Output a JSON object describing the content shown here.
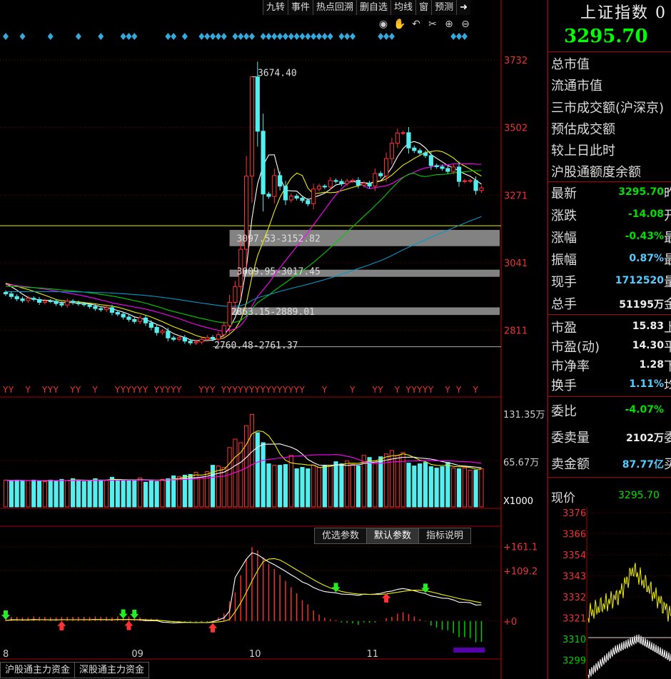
{
  "toolbar": {
    "items": [
      "九转",
      "事件",
      "热点回溯",
      "删自选",
      "均线",
      "窗",
      "预测"
    ],
    "exit_icon": "exit-icon"
  },
  "controls": [
    "eye-icon",
    "hand-icon",
    "undo-icon",
    "scissors-icon",
    "zoom-in-icon",
    "zoom-out-icon"
  ],
  "right_panel": {
    "title": "上证指数 0",
    "price": "3295.70",
    "static_rows": [
      "总市值",
      "流通市值",
      "三市成交额(沪深京)",
      "预估成交额",
      "较上日此时",
      "沪股通额度余额"
    ],
    "quote_rows": [
      {
        "label": "最新",
        "value": "3295.70",
        "color": "green",
        "tail": "昨"
      },
      {
        "label": "涨跌",
        "value": "-14.08",
        "color": "green",
        "tail": "开"
      },
      {
        "label": "涨幅",
        "value": "-0.43%",
        "color": "green",
        "tail": "最"
      },
      {
        "label": "振幅",
        "value": "0.87%",
        "color": "cyan",
        "tail": "最"
      },
      {
        "label": "现手",
        "value": "1712520",
        "color": "cyan",
        "tail": "量"
      },
      {
        "label": "总手",
        "value": "51195万",
        "color": "white",
        "tail": "金"
      }
    ],
    "val_rows": [
      {
        "label": "市盈",
        "value": "15.83",
        "color": "white",
        "tail": "上"
      },
      {
        "label": "市盈(动)",
        "value": "14.30",
        "color": "white",
        "tail": "平"
      },
      {
        "label": "市净率",
        "value": "1.28",
        "color": "white",
        "tail": "下"
      },
      {
        "label": "换手",
        "value": "1.11%",
        "color": "cyan",
        "tail": "均"
      }
    ],
    "order_rows": [
      {
        "label": "委比",
        "value": "-4.07%",
        "color": "green",
        "tail": ""
      },
      {
        "label": "委卖量",
        "value": "2102万",
        "color": "white",
        "tail": "委"
      },
      {
        "label": "卖金额",
        "value": "87.77亿",
        "color": "cyan",
        "tail": "买"
      }
    ],
    "now_label": "现价",
    "now_value": "3295.70",
    "mini_axis": [
      "3376",
      "3366",
      "3354",
      "3343",
      "3332",
      "3321",
      "3310",
      "3299"
    ]
  },
  "indicator_buttons": [
    "优选参数",
    "默认参数",
    "指标说明"
  ],
  "bottom_tabs": [
    "沪股通主力资金",
    "深股通主力资金"
  ],
  "chart_data": {
    "type": "candlestick",
    "price_axis_labels": [
      "3732",
      "3502",
      "3271",
      "3041",
      "2811"
    ],
    "price_range": [
      2720,
      3790
    ],
    "annotations": [
      "3674.40",
      "3097.53-3152.82",
      "3009.95-3017.45",
      "2863.15-2889.01",
      "2760.48-2761.37"
    ],
    "zones": [
      [
        3097.53,
        3152.82
      ],
      [
        3009.95,
        3017.45
      ],
      [
        2863.15,
        2889.01
      ]
    ],
    "horizontal_line": 3167,
    "volume_axis_labels": [
      "131.35万",
      "65.67万",
      "X1000"
    ],
    "volume_max": 131.35,
    "macd_axis_labels": [
      "+161.1",
      "+109.2",
      "+0"
    ],
    "macd_range": [
      -70,
      170
    ],
    "x_labels": [
      "8",
      "09",
      "10",
      "11"
    ],
    "closes": [
      2935,
      2926,
      2918,
      2912,
      2920,
      2916,
      2906,
      2911,
      2910,
      2902,
      2897,
      2910,
      2905,
      2901,
      2898,
      2892,
      2885,
      2881,
      2888,
      2872,
      2866,
      2856,
      2848,
      2841,
      2853,
      2836,
      2821,
      2803,
      2808,
      2785,
      2780,
      2786,
      2774,
      2768,
      2771,
      2780,
      2787,
      2781,
      2796,
      2827,
      2906,
      2960,
      3087,
      3336,
      3674,
      3489,
      3275,
      3267,
      3338,
      3302,
      3255,
      3268,
      3261,
      3253,
      3242,
      3292,
      3302,
      3299,
      3321,
      3318,
      3310,
      3319,
      3322,
      3305,
      3312,
      3302,
      3345,
      3337,
      3396,
      3448,
      3483,
      3484,
      3432,
      3423,
      3415,
      3406,
      3372,
      3368,
      3362,
      3352,
      3367,
      3318,
      3320,
      3321,
      3287,
      3296
    ],
    "volumes": [
      38,
      37,
      38,
      37,
      37,
      38,
      37,
      36,
      38,
      37,
      39,
      37,
      40,
      38,
      36,
      37,
      40,
      38,
      38,
      42,
      37,
      38,
      37,
      38,
      41,
      35,
      38,
      36,
      39,
      40,
      44,
      43,
      45,
      46,
      49,
      42,
      50,
      59,
      58,
      56,
      84,
      96,
      91,
      115,
      131,
      105,
      91,
      61,
      59,
      59,
      60,
      73,
      54,
      56,
      54,
      59,
      56,
      59,
      59,
      64,
      61,
      65,
      60,
      58,
      73,
      70,
      65,
      71,
      75,
      80,
      73,
      77,
      62,
      58,
      61,
      63,
      57,
      55,
      57,
      63,
      55,
      54,
      55,
      52,
      52,
      54
    ],
    "macd_bars": [
      6,
      9,
      9,
      8,
      8,
      10,
      9,
      9,
      8,
      8,
      9,
      9,
      9,
      9,
      9,
      9,
      10,
      9,
      9,
      8,
      10,
      10,
      10,
      9,
      8,
      5,
      5,
      5,
      -1,
      -2,
      -4,
      -3,
      -2,
      -2,
      -3,
      -2,
      -3,
      1,
      8,
      16,
      43,
      62,
      99,
      135,
      160,
      153,
      138,
      124,
      113,
      100,
      87,
      73,
      60,
      45,
      36,
      23,
      14,
      7,
      4,
      2,
      -3,
      -4,
      -5,
      -8,
      -3,
      -4,
      -3,
      0,
      6,
      9,
      16,
      19,
      15,
      10,
      4,
      -1,
      -10,
      -14,
      -19,
      -20,
      -26,
      -35,
      -35,
      -37,
      -46,
      -45
    ]
  }
}
